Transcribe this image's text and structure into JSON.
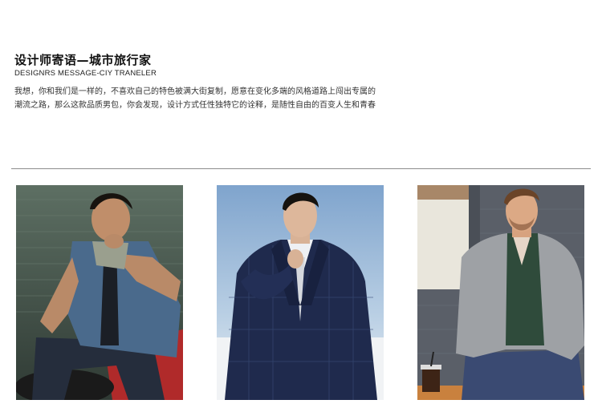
{
  "header": {
    "title": "设计师寄语—城市旅行家",
    "subtitle": "DESIGNRS MESSAGE-CIY TRANELER",
    "description": "我想，你和我们是一样的，不喜欢自己的特色被满大街复制，愿意在变化多端的风格道路上闯出专属的潮流之路，那么这款品质男包，你会发现，设计方式任性独特它的诠释，是随性自由的百变人生和青春"
  },
  "photos": [
    {
      "subject": "man-in-denim-vest-photo"
    },
    {
      "subject": "man-in-navy-suit-photo"
    },
    {
      "subject": "man-in-grey-blazer-photo"
    }
  ],
  "colors": {
    "divider": "#8c8c8c",
    "text": "#111111"
  }
}
